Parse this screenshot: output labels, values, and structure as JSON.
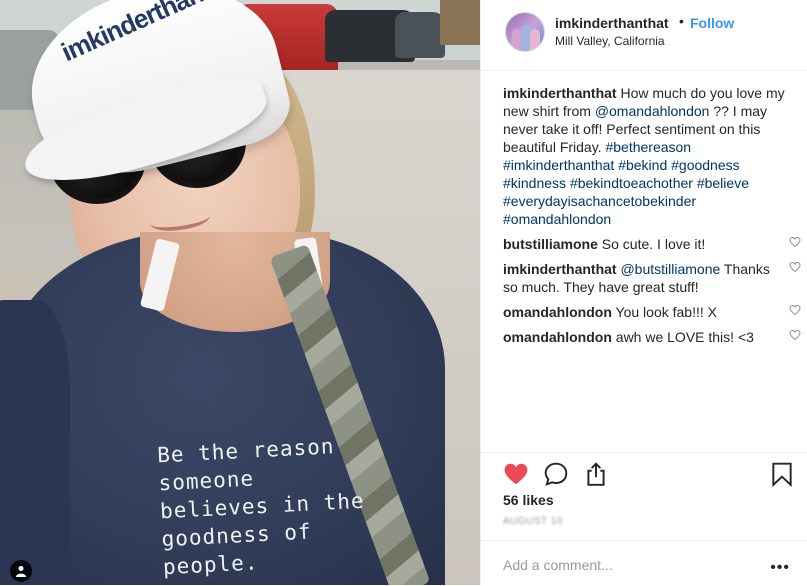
{
  "photo": {
    "cap_text": "imkinderthanthat",
    "shirt_text": "Be the reason\nsomeone\nbelieves in the\ngoodness of\npeople."
  },
  "header": {
    "username": "imkinderthanthat",
    "separator": "•",
    "follow_label": "Follow",
    "location": "Mill Valley, California"
  },
  "caption": {
    "user": "imkinderthanthat",
    "segments": [
      {
        "text": " How much do you love my new shirt from ",
        "tag": false
      },
      {
        "text": "@omandahlondon",
        "tag": true
      },
      {
        "text": " ?? I may never take it off! Perfect sentiment on this beautiful Friday. ",
        "tag": false
      },
      {
        "text": "#bethereason",
        "tag": true
      },
      {
        "text": " ",
        "tag": false
      },
      {
        "text": "#imkinderthanthat",
        "tag": true
      },
      {
        "text": " ",
        "tag": false
      },
      {
        "text": "#bekind",
        "tag": true
      },
      {
        "text": " ",
        "tag": false
      },
      {
        "text": "#goodness",
        "tag": true
      },
      {
        "text": " ",
        "tag": false
      },
      {
        "text": "#kindness",
        "tag": true
      },
      {
        "text": " ",
        "tag": false
      },
      {
        "text": "#bekindtoeachother",
        "tag": true
      },
      {
        "text": " ",
        "tag": false
      },
      {
        "text": "#believe",
        "tag": true
      },
      {
        "text": " ",
        "tag": false
      },
      {
        "text": "#everydayisachancetobekinder",
        "tag": true
      },
      {
        "text": " ",
        "tag": false
      },
      {
        "text": "#omandahlondon",
        "tag": true
      }
    ]
  },
  "comments": [
    {
      "user": "butstilliamone",
      "mention": "",
      "text": " So cute. I love it!"
    },
    {
      "user": "imkinderthanthat",
      "mention": " @butstilliamone",
      "text": " Thanks so much. They have great stuff!"
    },
    {
      "user": "omandahlondon",
      "mention": "",
      "text": " You look fab!!! X"
    },
    {
      "user": "omandahlondon",
      "mention": "",
      "text": " awh we LOVE this! <3"
    }
  ],
  "actions": {
    "like_icon": "heart-filled-icon",
    "comment_icon": "comment-bubble-icon",
    "share_icon": "share-icon",
    "save_icon": "bookmark-icon",
    "like_color": "#ed4956"
  },
  "likes": "56 likes",
  "date": "AUGUST 10",
  "add_comment": {
    "placeholder": "Add a comment...",
    "more": "•••"
  },
  "colors": {
    "link": "#3897f0",
    "hashtag": "#003569",
    "text": "#262626",
    "muted": "#999999"
  }
}
